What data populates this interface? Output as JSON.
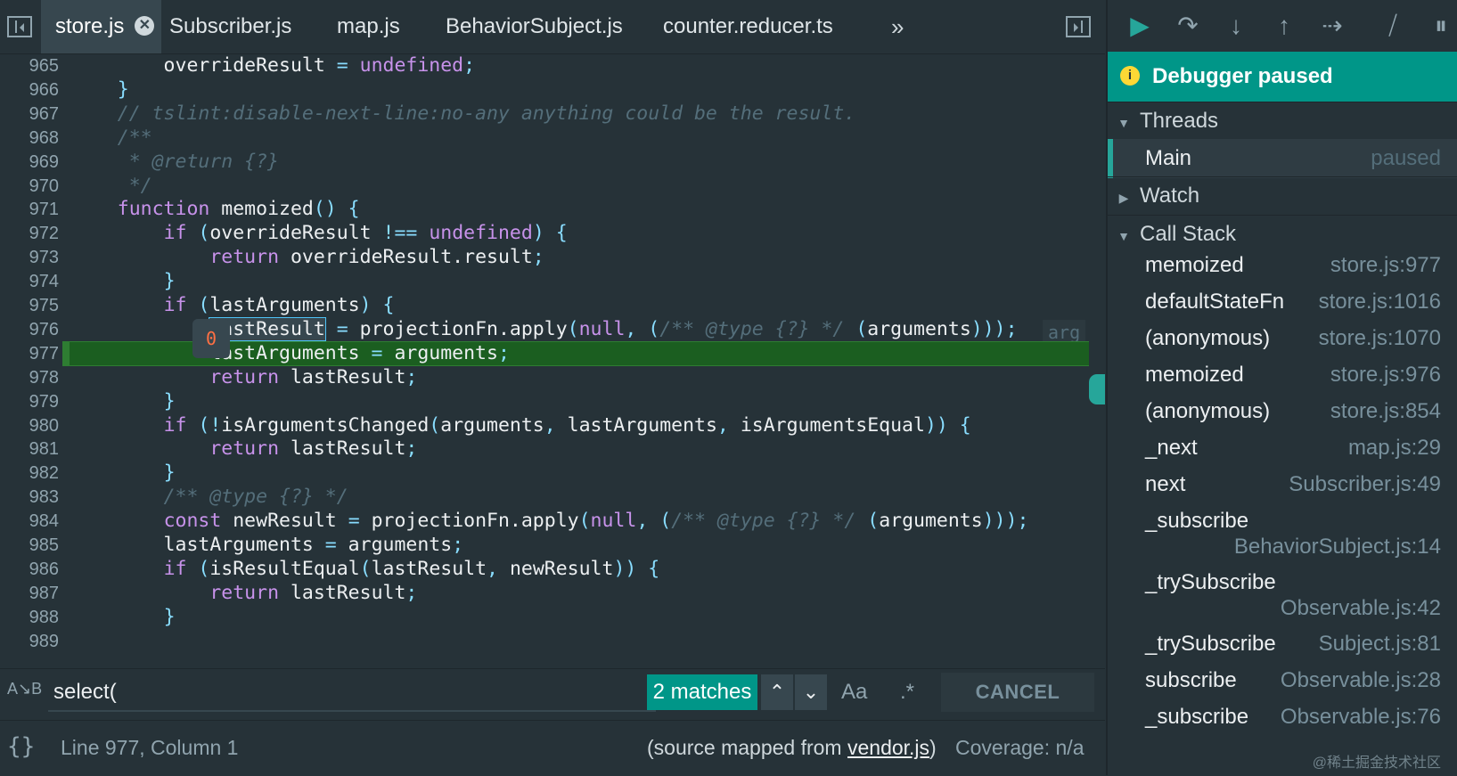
{
  "tabs": [
    "store.js",
    "Subscriber.js",
    "map.js",
    "BehaviorSubject.js",
    "counter.reducer.ts"
  ],
  "tab_close_glyph": "✕",
  "tabs_overflow_glyph": "»",
  "code_lines": [
    {
      "n": "965",
      "html": "        overrideResult <span class='op'>=</span> <span class='kw'>undefined</span><span class='pu'>;</span>"
    },
    {
      "n": "966",
      "html": "    <span class='pu'>}</span>"
    },
    {
      "n": "967",
      "html": "    <span class='cm'>// tslint:disable-next-line:no-any anything could be the result.</span>"
    },
    {
      "n": "968",
      "html": "    <span class='cm'>/**</span>"
    },
    {
      "n": "969",
      "html": "    <span class='cm'> * @return {?}</span>"
    },
    {
      "n": "970",
      "html": "    <span class='cm'> */</span>"
    },
    {
      "n": "971",
      "html": "    <span class='kw'>function</span> memoized<span class='pu'>() {</span>"
    },
    {
      "n": "972",
      "html": "        <span class='kw'>if</span> <span class='pu'>(</span>overrideResult <span class='op'>!==</span> <span class='kw'>undefined</span><span class='pu'>) {</span>"
    },
    {
      "n": "973",
      "html": "            <span class='kw'>return</span> overrideResult.result<span class='pu'>;</span>"
    },
    {
      "n": "974",
      "html": "        <span class='pu'>}</span>"
    },
    {
      "n": "975",
      "html": "        <span class='kw'>if</span> <span class='pu'>(</span>lastArguments<span class='pu'>) {</span>"
    },
    {
      "n": "976",
      "html": "            <span class='sel-word'>lastResult</span> <span class='op'>=</span> projectionFn.apply<span class='pu'>(</span><span class='kw'>null</span><span class='pu'>,</span> <span class='pu'>(</span><span class='cm'>/** @type {?} */</span> <span class='pu'>(</span>arguments<span class='pu'>)));</span>"
    },
    {
      "n": "977",
      "html": "            lastArguments <span class='op'>=</span> arguments<span class='pu'>;</span>"
    },
    {
      "n": "978",
      "html": "            <span class='kw'>return</span> lastResult<span class='pu'>;</span>"
    },
    {
      "n": "979",
      "html": "        <span class='pu'>}</span>"
    },
    {
      "n": "980",
      "html": "        <span class='kw'>if</span> <span class='pu'>(!</span>isArgumentsChanged<span class='pu'>(</span>arguments<span class='pu'>,</span> lastArguments<span class='pu'>,</span> isArgumentsEqual<span class='pu'>)) {</span>"
    },
    {
      "n": "981",
      "html": "            <span class='kw'>return</span> lastResult<span class='pu'>;</span>"
    },
    {
      "n": "982",
      "html": "        <span class='pu'>}</span>"
    },
    {
      "n": "983",
      "html": "        <span class='cm'>/** @type {?} */</span>"
    },
    {
      "n": "984",
      "html": "        <span class='kw'>const</span> newResult <span class='op'>=</span> projectionFn.apply<span class='pu'>(</span><span class='kw'>null</span><span class='pu'>,</span> <span class='pu'>(</span><span class='cm'>/** @type {?} */</span> <span class='pu'>(</span>arguments<span class='pu'>)));</span>"
    },
    {
      "n": "985",
      "html": "        lastArguments <span class='op'>=</span> arguments<span class='pu'>;</span>"
    },
    {
      "n": "986",
      "html": "        <span class='kw'>if</span> <span class='pu'>(</span>isResultEqual<span class='pu'>(</span>lastResult<span class='pu'>,</span> newResult<span class='pu'>)) {</span>"
    },
    {
      "n": "987",
      "html": "            <span class='kw'>return</span> lastResult<span class='pu'>;</span>"
    },
    {
      "n": "988",
      "html": "        <span class='pu'>}</span>"
    },
    {
      "n": "989",
      "html": ""
    }
  ],
  "current_line": "977",
  "inline_preview": "arg",
  "breakpoint_tooltip": "0",
  "search": {
    "value": "select(",
    "matches": "2 matches",
    "case_label": "Aa",
    "regex_label": ".*",
    "cancel": "CANCEL",
    "ab_icon": "A↘B"
  },
  "status": {
    "pretty_print_icon": "{}",
    "cursor": "Line 977, Column 1",
    "mapped_prefix": "(source mapped from ",
    "mapped_file": "vendor.js",
    "mapped_suffix": ")",
    "coverage": "Coverage: n/a"
  },
  "debugger": {
    "paused_banner": "Debugger paused",
    "threads_label": "Threads",
    "thread_name": "Main",
    "thread_status": "paused",
    "watch_label": "Watch",
    "callstack_label": "Call Stack",
    "frames": [
      {
        "fn": "memoized",
        "loc": "store.js:977",
        "wrap": false
      },
      {
        "fn": "defaultStateFn",
        "loc": "store.js:1016",
        "wrap": false
      },
      {
        "fn": "(anonymous)",
        "loc": "store.js:1070",
        "wrap": false
      },
      {
        "fn": "memoized",
        "loc": "store.js:976",
        "wrap": false
      },
      {
        "fn": "(anonymous)",
        "loc": "store.js:854",
        "wrap": false
      },
      {
        "fn": "_next",
        "loc": "map.js:29",
        "wrap": false
      },
      {
        "fn": "next",
        "loc": "Subscriber.js:49",
        "wrap": false
      },
      {
        "fn": "_subscribe",
        "loc": "BehaviorSubject.js:14",
        "wrap": true
      },
      {
        "fn": "_trySubscribe",
        "loc": "Observable.js:42",
        "wrap": true
      },
      {
        "fn": "_trySubscribe",
        "loc": "Subject.js:81",
        "wrap": false
      },
      {
        "fn": "subscribe",
        "loc": "Observable.js:28",
        "wrap": false
      },
      {
        "fn": "_subscribe",
        "loc": "Observable.js:76",
        "wrap": false
      }
    ]
  },
  "watermark": "@稀土掘金技术社区",
  "colors": {
    "accent": "#009688",
    "background": "#263238",
    "current_line": "#1b5e20",
    "keyword": "#c792ea"
  }
}
